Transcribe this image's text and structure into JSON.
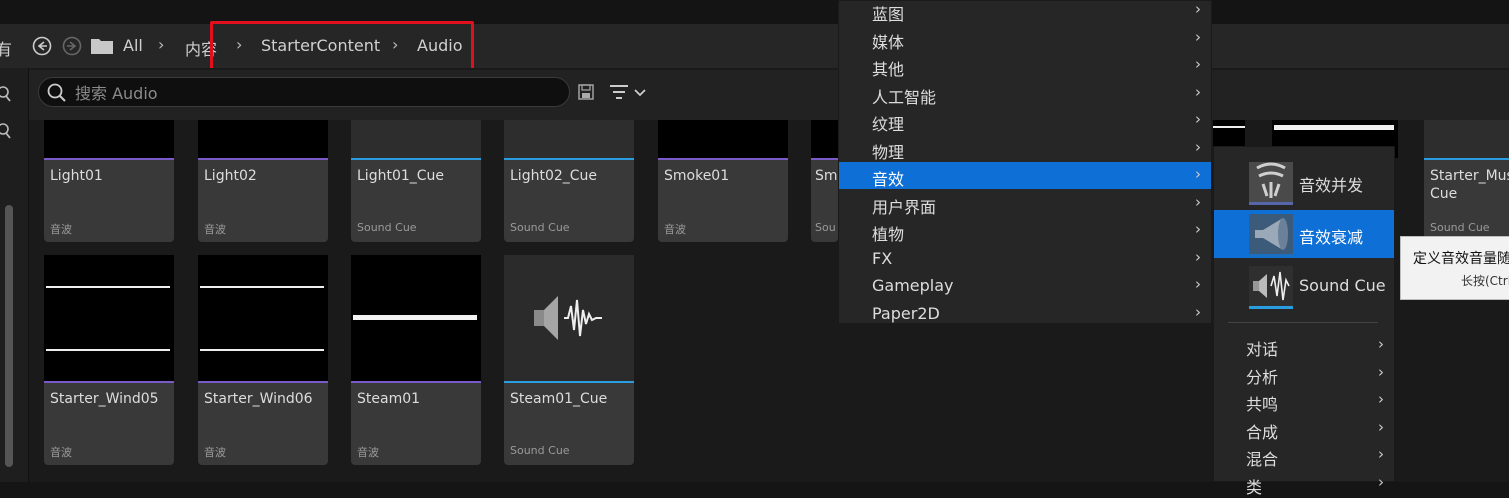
{
  "breadcrumb": {
    "cut_left": "有",
    "all": "All",
    "content": "内容",
    "starter": "StarterContent",
    "audio": "Audio"
  },
  "search": {
    "placeholder": "搜索 Audio"
  },
  "assets_row1": [
    {
      "name": "Light01",
      "type": "音波",
      "bar": "#7a5ac8"
    },
    {
      "name": "Light02",
      "type": "音波",
      "bar": "#7a5ac8"
    },
    {
      "name": "Light01_Cue",
      "type": "Sound Cue",
      "bar": "#2a9de0"
    },
    {
      "name": "Light02_Cue",
      "type": "Sound Cue",
      "bar": "#2a9de0"
    },
    {
      "name": "Smoke01",
      "type": "音波",
      "bar": "#7a5ac8"
    },
    {
      "name": "Sm",
      "type": "Sou",
      "bar": "#7a5ac8"
    }
  ],
  "assets_row2": [
    {
      "name": "Starter_Wind05",
      "type": "音波",
      "bar": "#7a5ac8"
    },
    {
      "name": "Starter_Wind06",
      "type": "音波",
      "bar": "#7a5ac8"
    },
    {
      "name": "Steam01",
      "type": "音波",
      "bar": "#7a5ac8"
    },
    {
      "name": "Steam01_Cue",
      "type": "Sound Cue",
      "bar": "#2a9de0"
    }
  ],
  "right_tile": {
    "name_line1": "Starter_Mus",
    "name_line2": "Cue",
    "type": "Sound Cue"
  },
  "menu": {
    "items": [
      "蓝图",
      "媒体",
      "其他",
      "人工智能",
      "纹理",
      "物理",
      "音效",
      "用户界面",
      "植物",
      "FX",
      "Gameplay",
      "Paper2D"
    ],
    "selected": "音效"
  },
  "submenu": {
    "items": [
      {
        "label": "音效并发",
        "icon": "sound-concurrency-icon",
        "bar": "#5566aa"
      },
      {
        "label": "音效衰减",
        "icon": "sound-attenuation-icon",
        "bar": "#1b6fc0"
      },
      {
        "label": "Sound Cue",
        "icon": "sound-cue-icon",
        "bar": "#2a9de0"
      }
    ],
    "selected": "音效衰减",
    "subitems": [
      "对话",
      "分析",
      "共鸣",
      "合成",
      "混合",
      "类"
    ]
  },
  "tooltip": {
    "text": "定义音效音量随",
    "hint": "长按(Ctrl"
  },
  "colors": {
    "accent": "#0e6fd6",
    "highlight_box": "#e0101e"
  }
}
